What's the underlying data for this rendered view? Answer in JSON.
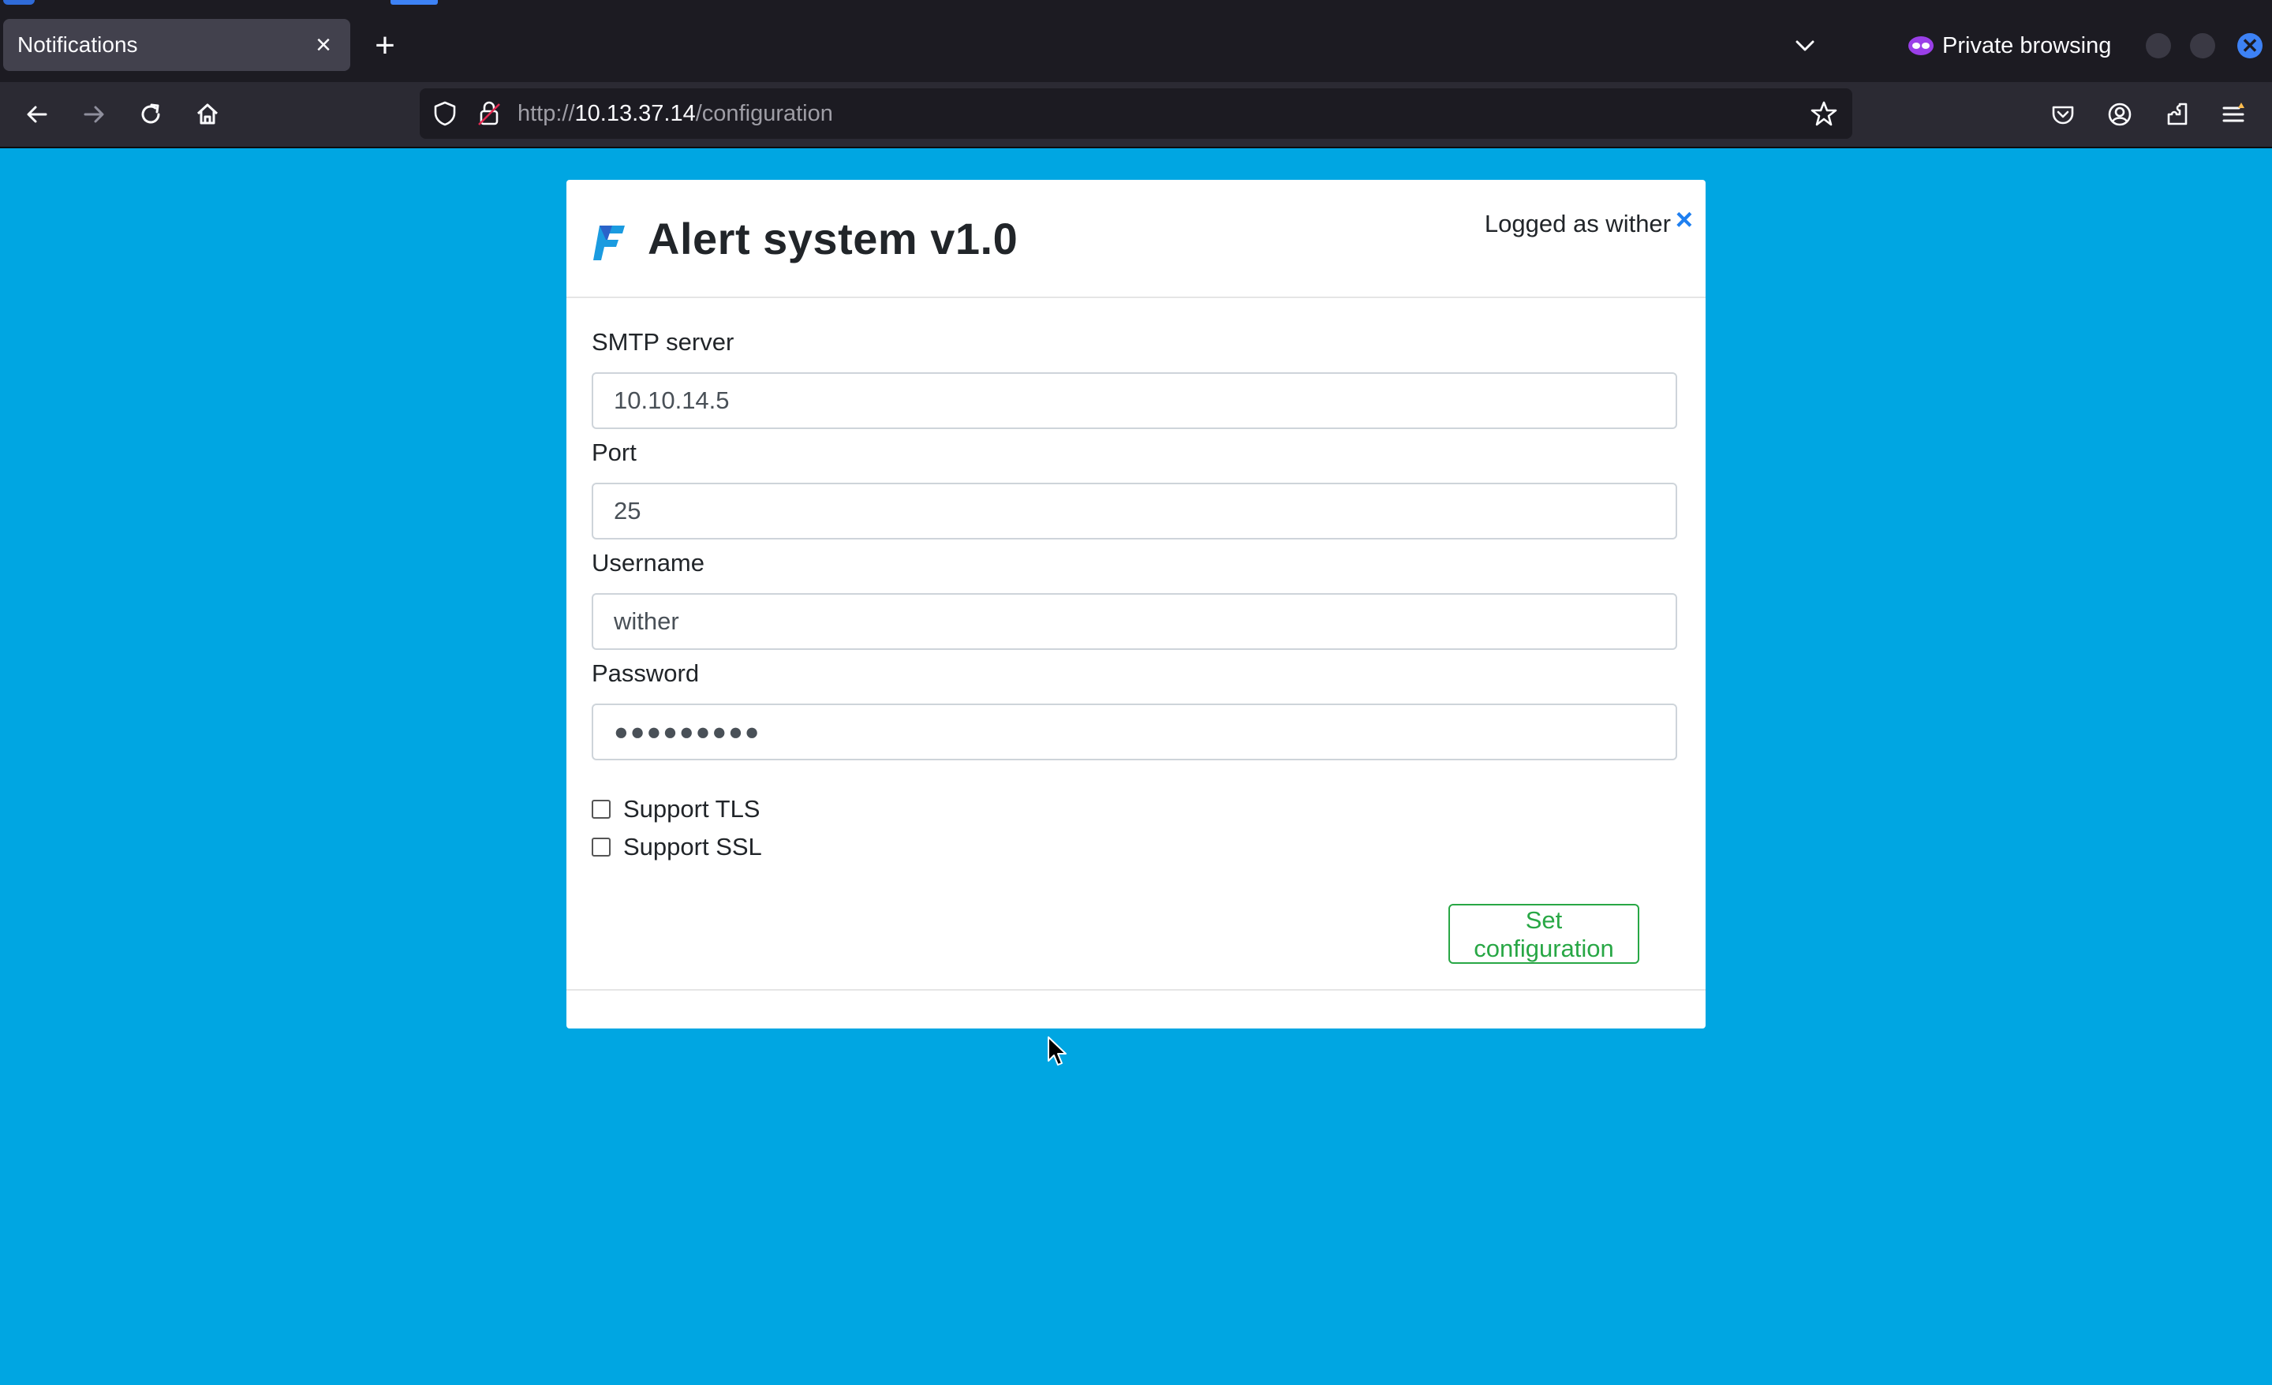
{
  "browser": {
    "tab": {
      "title": "Notifications",
      "close_glyph": "×"
    },
    "new_tab_glyph": "+",
    "private_label": "Private browsing",
    "url": {
      "prefix": "http://",
      "host": "10.13.37.14",
      "path": "/configuration"
    },
    "icons": [
      "back-icon",
      "forward-icon",
      "reload-icon",
      "home-icon",
      "shield-icon",
      "lock-icon",
      "star-icon",
      "pocket-icon",
      "account-icon",
      "extensions-icon",
      "menu-icon"
    ],
    "accent": "#3d82f5"
  },
  "page": {
    "background": "#00a6e2",
    "app_title": "Alert system v1.0",
    "logged_as": "Logged as wither",
    "logout_glyph": "×",
    "form": {
      "smtp_label": "SMTP server",
      "smtp_value": "10.10.14.5",
      "port_label": "Port",
      "port_value": "25",
      "username_label": "Username",
      "username_value": "wither",
      "password_label": "Password",
      "password_value": "●●●●●●●●●",
      "tls_label": "Support TLS",
      "tls_checked": false,
      "ssl_label": "Support SSL",
      "ssl_checked": false,
      "submit_label": "Set configuration",
      "submit_color": "#28a745"
    }
  }
}
